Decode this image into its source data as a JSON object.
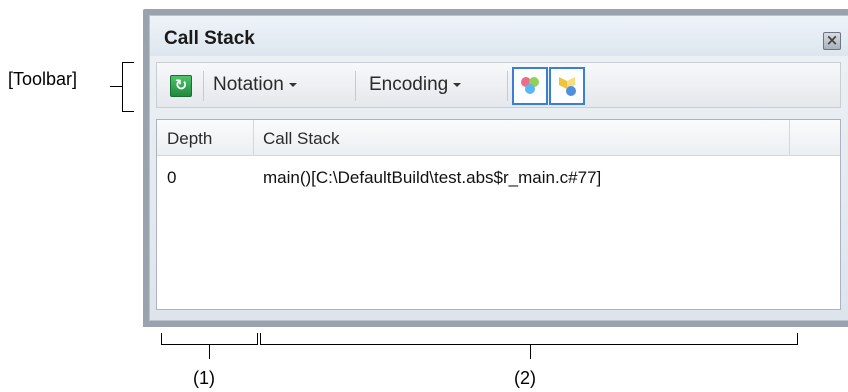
{
  "callouts": {
    "toolbar": "[Toolbar]",
    "depth_column": "(1)",
    "callstack_column": "(2)"
  },
  "panel": {
    "title": "Call Stack",
    "close_icon": "close-icon"
  },
  "toolbar": {
    "refresh_icon": "refresh-icon",
    "notation_label": "Notation",
    "encoding_label": "Encoding",
    "toggle_1_icon": "display-function-icon",
    "toggle_2_icon": "display-arguments-icon"
  },
  "table": {
    "columns": [
      "Depth",
      "Call Stack"
    ],
    "rows": [
      {
        "depth": "0",
        "call_stack": "main()[C:\\DefaultBuild\\test.abs$r_main.c#77]"
      }
    ]
  },
  "colors": {
    "panel_border": "#9aa3ad",
    "toggle_highlight": "#3a7fd5",
    "refresh_green": "#1f8a3c"
  }
}
